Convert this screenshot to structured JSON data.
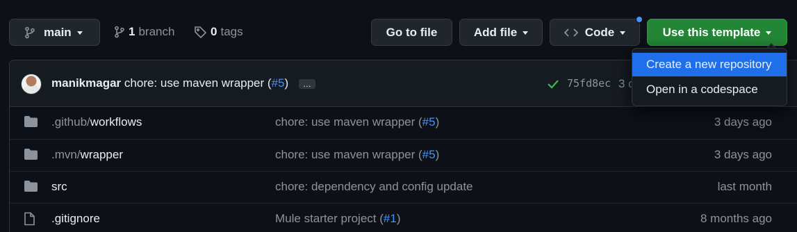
{
  "toolbar": {
    "branch_button": "main",
    "branches": {
      "count": "1",
      "label": "branch"
    },
    "tags": {
      "count": "0",
      "label": "tags"
    },
    "go_to_file": "Go to file",
    "add_file": "Add file",
    "code": "Code",
    "use_template": "Use this template"
  },
  "dropdown": {
    "items": [
      "Create a new repository",
      "Open in a codespace"
    ]
  },
  "commit": {
    "author": "manikmagar",
    "message": "chore: use maven wrapper (",
    "pr": "#5",
    "message_end": ")",
    "ellipsis": "…",
    "sha": "75fd8ec",
    "time_partial": "3 d"
  },
  "files": [
    {
      "type": "folder",
      "prefix": ".github/",
      "name": "workflows",
      "msg": "chore: use maven wrapper (",
      "pr": "#5",
      "msg_end": ")",
      "age": "3 days ago"
    },
    {
      "type": "folder",
      "prefix": ".mvn/",
      "name": "wrapper",
      "msg": "chore: use maven wrapper (",
      "pr": "#5",
      "msg_end": ")",
      "age": "3 days ago"
    },
    {
      "type": "folder",
      "prefix": "",
      "name": "src",
      "msg": "chore: dependency and config update",
      "pr": "",
      "msg_end": "",
      "age": "last month"
    },
    {
      "type": "file",
      "prefix": "",
      "name": ".gitignore",
      "msg": "Mule starter project (",
      "pr": "#1",
      "msg_end": ")",
      "age": "8 months ago"
    }
  ],
  "colors": {
    "background": "#0d1117",
    "primary_green": "#238636",
    "accent_blue": "#1f6feb",
    "link_blue": "#4493f8",
    "check_green": "#3fb950"
  },
  "icons": [
    "branch-icon",
    "branches-icon",
    "tag-icon",
    "code-icon",
    "check-icon",
    "folder-icon",
    "file-icon"
  ]
}
